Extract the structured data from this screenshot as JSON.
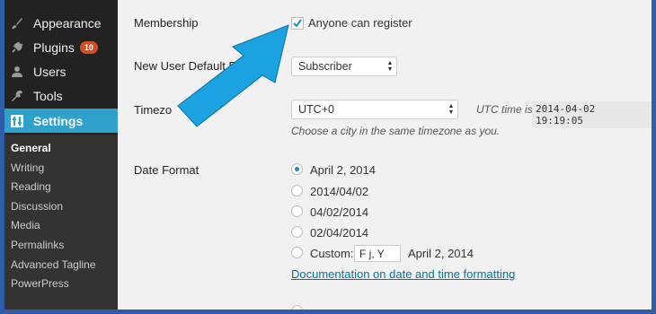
{
  "sidebar": {
    "items": [
      {
        "label": "Appearance",
        "icon": "paintbrush-icon"
      },
      {
        "label": "Plugins",
        "icon": "plug-icon",
        "badge": "10"
      },
      {
        "label": "Users",
        "icon": "user-icon"
      },
      {
        "label": "Tools",
        "icon": "wrench-icon"
      },
      {
        "label": "Settings",
        "icon": "settings-icon",
        "active": true
      }
    ],
    "submenu": [
      "General",
      "Writing",
      "Reading",
      "Discussion",
      "Media",
      "Permalinks",
      "Advanced Tagline",
      "PowerPress"
    ],
    "current_submenu": "General"
  },
  "settings": {
    "membership": {
      "label": "Membership",
      "checkbox_label": "Anyone can register",
      "checked": true
    },
    "default_role": {
      "label": "New User Default R",
      "value": "Subscriber"
    },
    "timezone": {
      "label": "Timezo",
      "value": "UTC+0",
      "utc_label": "UTC time is",
      "utc_time": "2014-04-02 19:19:05",
      "help": "Choose a city in the same timezone as you."
    },
    "date_format": {
      "label": "Date Format",
      "options": [
        "April 2, 2014",
        "2014/04/02",
        "04/02/2014",
        "02/04/2014"
      ],
      "selected": "April 2, 2014",
      "custom_label": "Custom:",
      "custom_value": "F j, Y",
      "custom_preview": "April 2, 2014",
      "doc_link": "Documentation on date and time formatting",
      "doc_suffix": "."
    }
  },
  "colors": {
    "accent": "#2ea2cc",
    "badge": "#d54e21",
    "link": "#0074a2",
    "callout_arrow": "#1aa3e0",
    "frame": "#2f5ea8"
  }
}
